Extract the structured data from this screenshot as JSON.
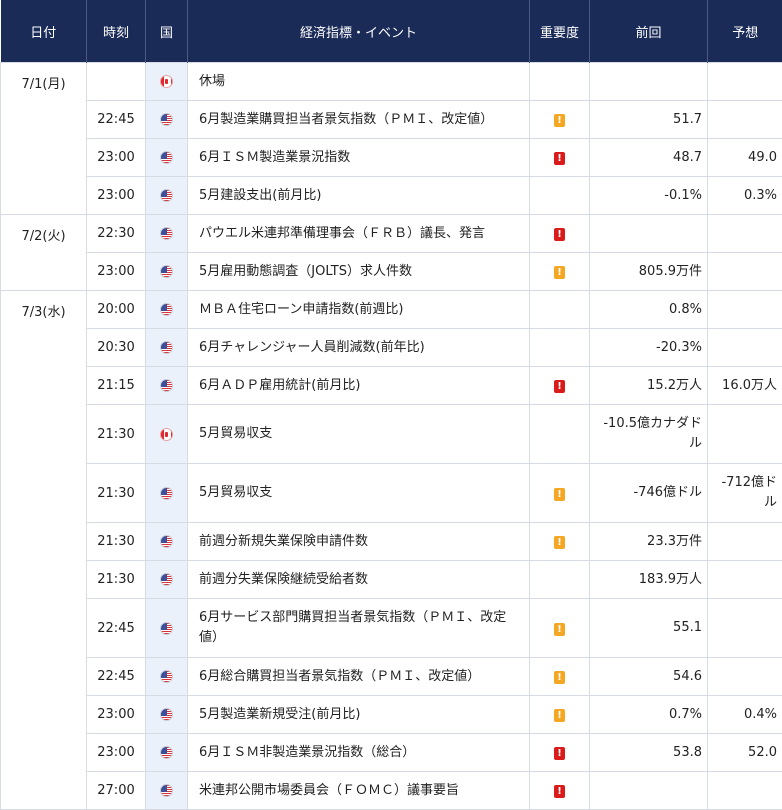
{
  "header": {
    "date": "日付",
    "time": "時刻",
    "country": "国",
    "event": "経済指標・イベント",
    "importance": "重要度",
    "previous": "前回",
    "forecast": "予想"
  },
  "colors": {
    "header_bg": "#1a2b58",
    "importance_mid": "#f5a623",
    "importance_high": "#d91b1b"
  },
  "importance_glyph": "!",
  "rows": [
    {
      "date": "7/1(月)",
      "time": "",
      "country": "canada-flag-icon",
      "event": "休場",
      "importance": "",
      "previous": "",
      "forecast": ""
    },
    {
      "date": "",
      "time": "22:45",
      "country": "us-flag-icon",
      "event": "6月製造業購買担当者景気指数（ＰＭＩ、改定値）",
      "importance": "mid",
      "previous": "51.7",
      "forecast": ""
    },
    {
      "date": "",
      "time": "23:00",
      "country": "us-flag-icon",
      "event": "6月ＩＳＭ製造業景況指数",
      "importance": "high",
      "previous": "48.7",
      "forecast": "49.0"
    },
    {
      "date": "",
      "time": "23:00",
      "country": "us-flag-icon",
      "event": "5月建設支出(前月比)",
      "importance": "",
      "previous": "-0.1%",
      "forecast": "0.3%"
    },
    {
      "date": "7/2(火)",
      "time": "22:30",
      "country": "us-flag-icon",
      "event": "パウエル米連邦準備理事会（ＦＲＢ）議長、発言",
      "importance": "high",
      "previous": "",
      "forecast": ""
    },
    {
      "date": "",
      "time": "23:00",
      "country": "us-flag-icon",
      "event": "5月雇用動態調査（JOLTS）求人件数",
      "importance": "mid",
      "previous": "805.9万件",
      "forecast": ""
    },
    {
      "date": "7/3(水)",
      "time": "20:00",
      "country": "us-flag-icon",
      "event": "ＭＢＡ住宅ローン申請指数(前週比)",
      "importance": "",
      "previous": "0.8%",
      "forecast": ""
    },
    {
      "date": "",
      "time": "20:30",
      "country": "us-flag-icon",
      "event": "6月チャレンジャー人員削減数(前年比)",
      "importance": "",
      "previous": "-20.3%",
      "forecast": ""
    },
    {
      "date": "",
      "time": "21:15",
      "country": "us-flag-icon",
      "event": "6月ＡＤＰ雇用統計(前月比)",
      "importance": "high",
      "previous": "15.2万人",
      "forecast": "16.0万人"
    },
    {
      "date": "",
      "time": "21:30",
      "country": "canada-flag-icon",
      "event": "5月貿易収支",
      "importance": "",
      "previous": "-10.5億カナダドル",
      "forecast": ""
    },
    {
      "date": "",
      "time": "21:30",
      "country": "us-flag-icon",
      "event": "5月貿易収支",
      "importance": "mid",
      "previous": "-746億ドル",
      "forecast": "-712億ドル"
    },
    {
      "date": "",
      "time": "21:30",
      "country": "us-flag-icon",
      "event": "前週分新規失業保険申請件数",
      "importance": "mid",
      "previous": "23.3万件",
      "forecast": ""
    },
    {
      "date": "",
      "time": "21:30",
      "country": "us-flag-icon",
      "event": "前週分失業保険継続受給者数",
      "importance": "",
      "previous": "183.9万人",
      "forecast": ""
    },
    {
      "date": "",
      "time": "22:45",
      "country": "us-flag-icon",
      "event": "6月サービス部門購買担当者景気指数（ＰＭＩ、改定値）",
      "importance": "mid",
      "previous": "55.1",
      "forecast": ""
    },
    {
      "date": "",
      "time": "22:45",
      "country": "us-flag-icon",
      "event": "6月総合購買担当者景気指数（ＰＭＩ、改定値）",
      "importance": "mid",
      "previous": "54.6",
      "forecast": ""
    },
    {
      "date": "",
      "time": "23:00",
      "country": "us-flag-icon",
      "event": "5月製造業新規受注(前月比)",
      "importance": "mid",
      "previous": "0.7%",
      "forecast": "0.4%"
    },
    {
      "date": "",
      "time": "23:00",
      "country": "us-flag-icon",
      "event": "6月ＩＳＭ非製造業景況指数（総合）",
      "importance": "high",
      "previous": "53.8",
      "forecast": "52.0"
    },
    {
      "date": "",
      "time": "27:00",
      "country": "us-flag-icon",
      "event": "米連邦公開市場委員会（ＦＯＭＣ）議事要旨",
      "importance": "high",
      "previous": "",
      "forecast": ""
    }
  ]
}
